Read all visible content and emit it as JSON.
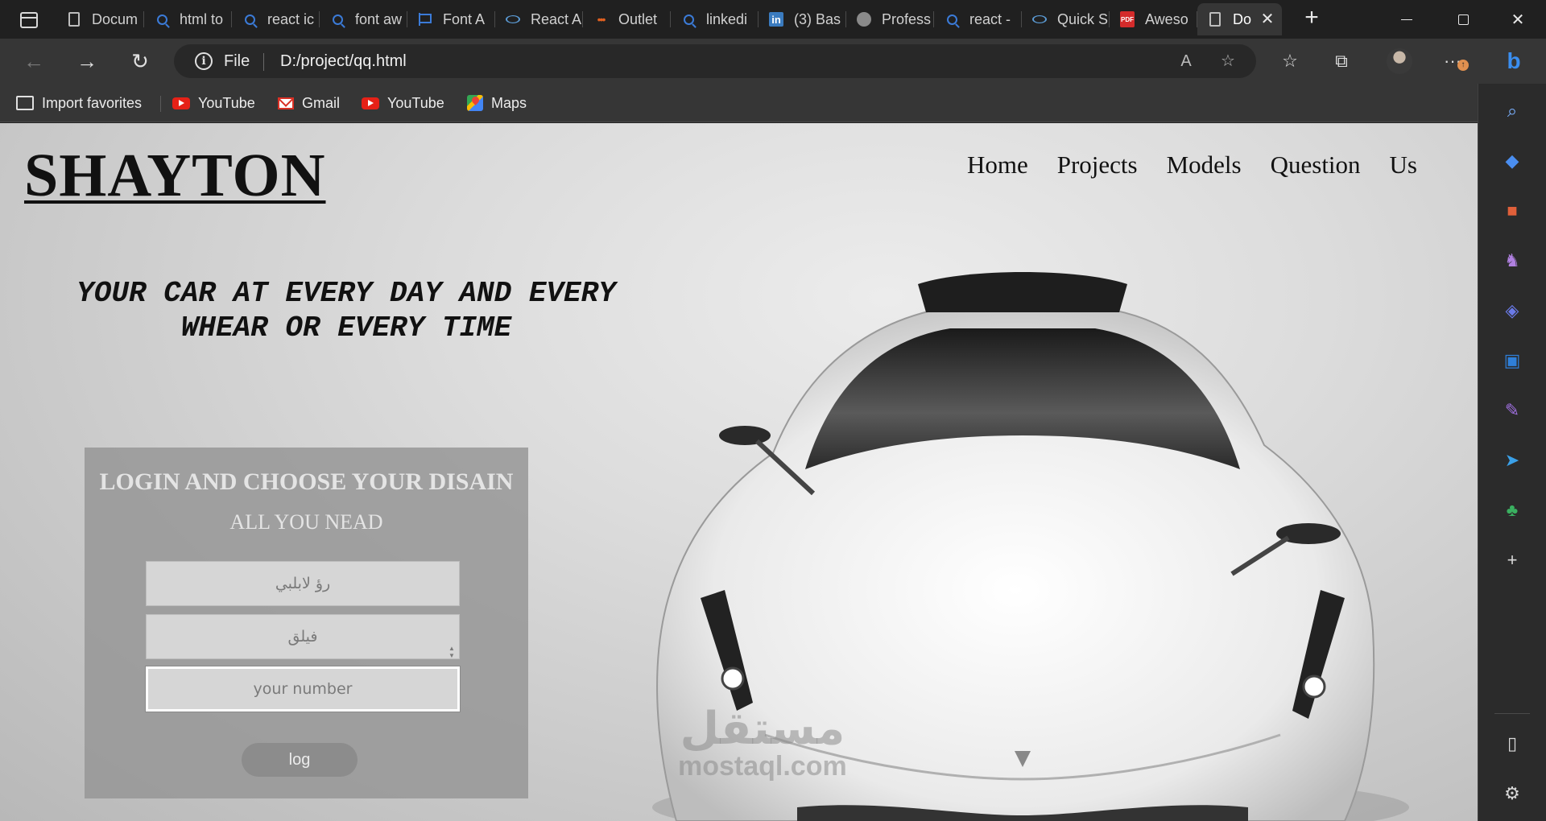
{
  "browser": {
    "tabs": [
      {
        "label": "Docum",
        "icon": "document-icon"
      },
      {
        "label": "html to",
        "icon": "search-icon"
      },
      {
        "label": "react ic",
        "icon": "search-icon"
      },
      {
        "label": "font aw",
        "icon": "search-icon"
      },
      {
        "label": "Font A",
        "icon": "flag-icon"
      },
      {
        "label": "React A",
        "icon": "react-icon"
      },
      {
        "label": "Outlet",
        "icon": "dots-icon"
      },
      {
        "label": "linkedi",
        "icon": "search-icon"
      },
      {
        "label": "(3) Bas",
        "icon": "linkedin-icon"
      },
      {
        "label": "Profess",
        "icon": "circle-icon"
      },
      {
        "label": "react -",
        "icon": "search-icon"
      },
      {
        "label": "Quick S",
        "icon": "react-icon"
      },
      {
        "label": "Aweso",
        "icon": "pdf-icon"
      },
      {
        "label": "Do",
        "icon": "document-icon",
        "active": true
      }
    ],
    "address": {
      "scheme": "File",
      "url": "D:/project/qq.html"
    },
    "favorites": [
      {
        "label": "Import favorites",
        "icon": "import-icon"
      },
      {
        "label": "YouTube",
        "icon": "youtube-icon"
      },
      {
        "label": "Gmail",
        "icon": "gmail-icon"
      },
      {
        "label": "YouTube",
        "icon": "youtube-icon"
      },
      {
        "label": "Maps",
        "icon": "maps-icon"
      }
    ],
    "sidebar_icons": [
      "search-icon",
      "tag-icon",
      "toolbox-icon",
      "chess-icon",
      "copilot-icon",
      "outlook-icon",
      "edit-icon",
      "send-icon",
      "tree-icon",
      "add-icon",
      "split-icon",
      "settings-icon"
    ]
  },
  "page": {
    "brand": "SHAYTON",
    "nav": [
      "Home",
      "Projects",
      "Models",
      "Question",
      "Us"
    ],
    "tagline": "YOUR CAR AT EVERY DAY AND EVERY WHEAR OR EVERY TIME",
    "login": {
      "title": "LOGIN AND CHOOSE YOUR DISAIN",
      "subtitle": "ALL YOU NEAD",
      "field1_placeholder": "رؤ لابلبي",
      "field2_placeholder": "فيلق",
      "number_placeholder": "your number",
      "button_label": "log"
    },
    "watermark": {
      "arabic": "مستقل",
      "latin": "mostaql.com"
    }
  },
  "colors": {
    "chrome_dark": "#202020",
    "chrome_toolbar": "#363636",
    "accent_blue": "#3a8ef0",
    "page_bg": "#dcdcdc",
    "login_panel": "#969696"
  }
}
